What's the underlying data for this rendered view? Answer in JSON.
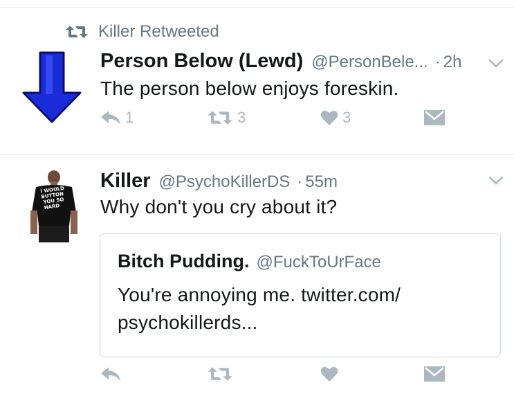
{
  "retweet_context": {
    "label": "Killer Retweeted"
  },
  "tweet1": {
    "name": "Person Below (Lewd)",
    "handle": "@PersonBele...",
    "separator": "·",
    "time": "2h",
    "text": "The person below enjoys foreskin.",
    "reply_count": "1",
    "retweet_count": "3",
    "like_count": "3"
  },
  "tweet2": {
    "name": "Killer",
    "handle": "@PsychoKillerDS",
    "separator": "·",
    "time": "55m",
    "text": "Why don't you cry about it?",
    "avatar_shirt_text": "I WOULD BUTTON YOU SO HARD",
    "quote": {
      "name": "Bitch Pudding.",
      "handle": "@FuckToUrFace",
      "text_line1": "You're annoying me. twitter.com/",
      "text_line2": "psychokillerds..."
    }
  },
  "colors": {
    "text_primary": "#14171a",
    "text_secondary": "#657786",
    "icon_gray": "#aab8c2",
    "arrow_blue": "#1a2bd8",
    "divider": "#e1e8ed"
  },
  "icons": [
    "retweet-icon",
    "chevron-down-icon",
    "reply-icon",
    "like-icon",
    "direct-message-icon"
  ]
}
